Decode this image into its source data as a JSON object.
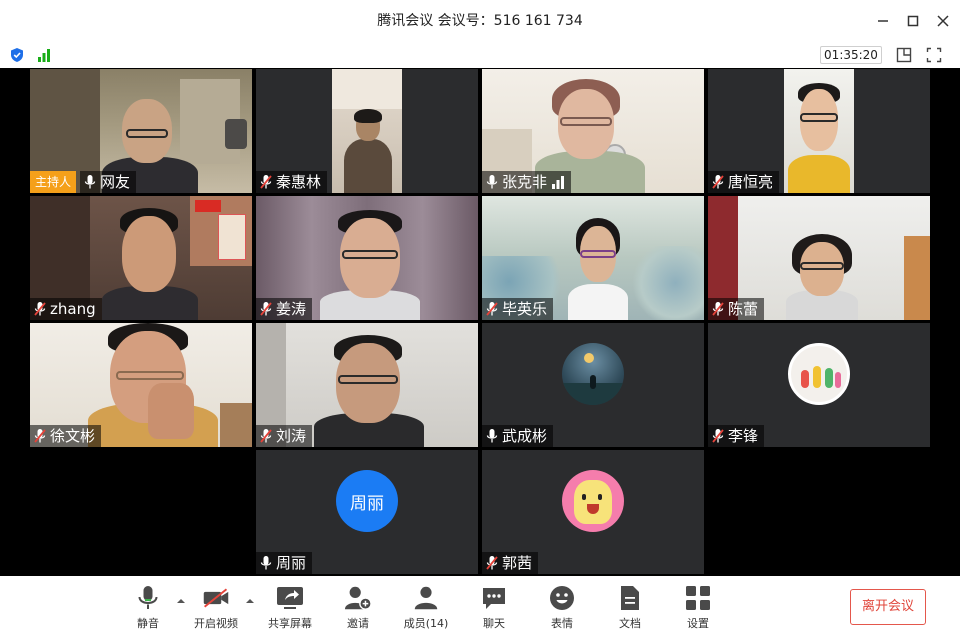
{
  "window": {
    "title": "腾讯会议 会议号：516 161 734"
  },
  "status": {
    "timer": "01:35:20"
  },
  "participants": [
    {
      "name": "网友",
      "host_badge": "主持人",
      "mic": "on"
    },
    {
      "name": "秦惠林",
      "mic": "muted"
    },
    {
      "name": "张克非",
      "mic": "on"
    },
    {
      "name": "唐恒亮",
      "mic": "muted"
    },
    {
      "name": "zhang",
      "mic": "muted"
    },
    {
      "name": "姜涛",
      "mic": "muted"
    },
    {
      "name": "毕英乐",
      "mic": "muted"
    },
    {
      "name": "陈蕾",
      "mic": "muted"
    },
    {
      "name": "徐文彬",
      "mic": "muted"
    },
    {
      "name": "刘涛",
      "mic": "muted"
    },
    {
      "name": "武成彬",
      "mic": "on"
    },
    {
      "name": "李锋",
      "mic": "muted"
    },
    {
      "name": "周丽",
      "avatar_text": "周丽",
      "mic": "on"
    },
    {
      "name": "郭茜",
      "mic": "muted"
    }
  ],
  "toolbar": {
    "mute": "静音",
    "video": "开启视频",
    "share": "共享屏幕",
    "invite": "邀请",
    "members": "成员(14)",
    "chat": "聊天",
    "reactions": "表情",
    "docs": "文档",
    "settings": "设置",
    "leave": "离开会议"
  },
  "colors": {
    "host_badge": "#f5a01a",
    "leave_red": "#e0453a",
    "avatar_blue": "#1b7cf4",
    "signal_green": "#1aad19",
    "shield_blue": "#1e6fe8"
  }
}
